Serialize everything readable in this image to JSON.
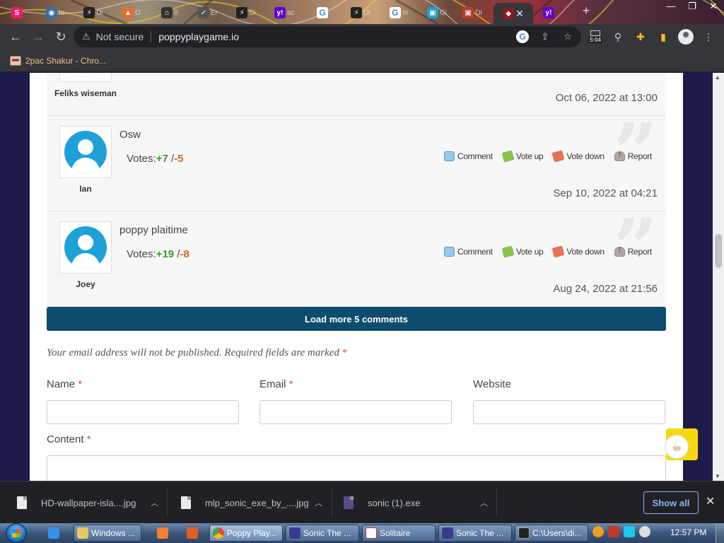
{
  "browser": {
    "tabs": [
      {
        "favicon": "S",
        "label": "",
        "color": "#e91e63"
      },
      {
        "favicon": "◉",
        "label": "Io",
        "color": "#3a6ea5"
      },
      {
        "favicon": "⚡",
        "label": "Di",
        "color": "#222222"
      },
      {
        "favicon": "▲",
        "label": "O",
        "color": "#e07030"
      },
      {
        "favicon": "⌂",
        "label": "0",
        "color": "#333333"
      },
      {
        "favicon": "✓",
        "label": "Er",
        "color": "#555555"
      },
      {
        "favicon": "⚡",
        "label": "Di",
        "color": "#222222"
      },
      {
        "favicon": "y!",
        "label": "sc",
        "color": "#6001d2"
      },
      {
        "favicon": "G",
        "label": "",
        "color": "#ffffff"
      },
      {
        "favicon": "⚡",
        "label": "Di",
        "color": "#222222"
      },
      {
        "favicon": "G",
        "label": "m",
        "color": "#ffffff"
      },
      {
        "favicon": "▣",
        "label": "Gi",
        "color": "#1da1d8"
      },
      {
        "favicon": "▣",
        "label": "Di",
        "color": "#c0392b"
      },
      {
        "favicon": "◆",
        "label": "",
        "color": "#8b1a1a",
        "active": true
      },
      {
        "favicon": "y!",
        "label": "",
        "color": "#6001d2"
      }
    ],
    "new_tab": "+",
    "window_controls": {
      "minimize": "—",
      "maximize": "❐",
      "close": "✕"
    },
    "security_label": "Not secure",
    "url": "poppyplaygame.io",
    "clock_ext": "5:04",
    "bookmark": "2pac Shakur - Chro..."
  },
  "comments": [
    {
      "author": "Feliks wiseman",
      "date": "Oct 06, 2022 at 13:00"
    },
    {
      "author": "Ian",
      "title": "Osw",
      "votes_label": "Votes:",
      "votes_up": "+7",
      "votes_sep": " /",
      "votes_down": "-5",
      "date": "Sep 10, 2022 at 04:21"
    },
    {
      "author": "Joey",
      "title": "poppy plaitime",
      "votes_label": "Votes:",
      "votes_up": "+19",
      "votes_sep": " /",
      "votes_down": "-8",
      "date": "Aug 24, 2022 at 21:56"
    }
  ],
  "actions": {
    "comment": "Comment",
    "vote_up": "Vote up",
    "vote_down": "Vote down",
    "report": "Report"
  },
  "load_more": "Load more 5 comments",
  "form": {
    "notice": "Your email address will not be published. Required fields are marked",
    "required_mark": "*",
    "name_label": "Name",
    "email_label": "Email",
    "website_label": "Website",
    "content_label": "Content"
  },
  "downloads": {
    "items": [
      {
        "name": "HD-wallpaper-isla....jpg"
      },
      {
        "name": "mlp_sonic_exe_by_....jpg"
      },
      {
        "name": "sonic (1).exe"
      }
    ],
    "show_all": "Show all",
    "close": "✕"
  },
  "taskbar": {
    "items": [
      {
        "label": "Windows ..."
      },
      {
        "label": "Poppy Play..."
      },
      {
        "label": "Sonic The ..."
      },
      {
        "label": "Solitaire"
      },
      {
        "label": "Sonic The ..."
      },
      {
        "label": "C:\\Users\\di..."
      }
    ],
    "clock": "12:57 PM"
  },
  "colors": {
    "vote_up": "#3d9b2f",
    "vote_down": "#d4652a",
    "load_more_bg": "#0e4c6e",
    "required": "#d9534f",
    "avatar": "#1da1d8",
    "float_button": "#f5d90a"
  }
}
